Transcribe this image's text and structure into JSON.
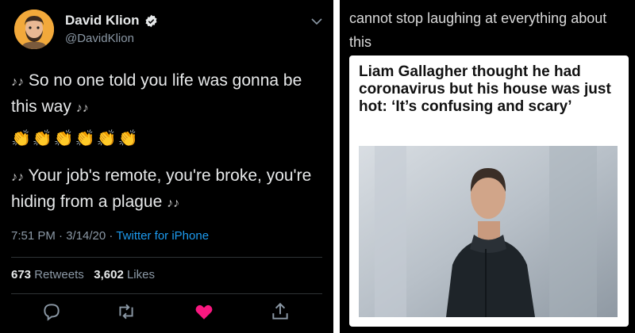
{
  "tweet": {
    "display_name": "David Klion",
    "handle": "@DavidKlion",
    "line1": "So no one told you life was gonna be this way",
    "emojis": "👏👏👏👏👏👏",
    "line2": "Your job's remote, you're broke, you're hiding from a plague",
    "time": "7:51 PM · 3/14/20 · ",
    "source": "Twitter for iPhone",
    "retweets_count": "673",
    "retweets_label": "Retweets",
    "likes_count": "3,602",
    "likes_label": "Likes"
  },
  "post": {
    "caption": "cannot stop laughing at everything about this",
    "headline": "Liam Gallagher thought he had coronavirus but his house was just hot: ‘It’s confusing and scary’"
  },
  "icons": [
    "verified-icon",
    "chevron-down-icon",
    "music-note-icon",
    "reply-icon",
    "retweet-icon",
    "like-icon",
    "share-icon"
  ],
  "colors": {
    "accent": "#1d9bf0",
    "like": "#f91880",
    "background": "#000000"
  }
}
